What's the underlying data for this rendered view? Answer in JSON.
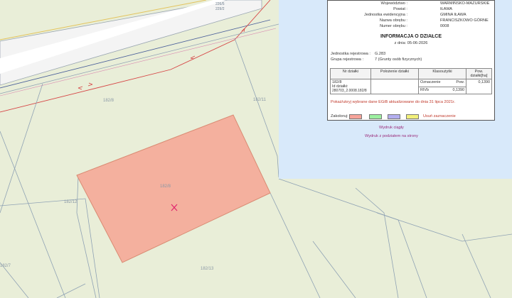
{
  "info_panel": {
    "voivodeship_label": "Województwo :",
    "voivodeship": "WARMIŃSKO-MAZURSKIE",
    "county_label": "Powiat :",
    "county": "IŁAWA",
    "unit_label": "Jednostka ewidencyjna :",
    "unit": "GMINA IŁAWA",
    "precinct_name_label": "Nazwa obrębu :",
    "precinct_name": "FRANCISZKOWO GÓRNE",
    "precinct_number_label": "Numer obrębu :",
    "precinct_number": "0008",
    "title": "INFORMACJA O DZIAŁCE",
    "date_line": "z dnia: 05-06-2026",
    "registry_unit_label": "Jednostka rejestrowa :",
    "registry_unit": "G.283",
    "registry_group_label": "Grupa rejestrowa :",
    "registry_group": "7 (Grunty osób fizycznych)",
    "table": {
      "headers": [
        "Nr działki",
        "Położenie działki",
        "Klasoużytki",
        "Pow. działki[ha]"
      ],
      "sub_headers": [
        "Oznaczenie",
        "Pow."
      ],
      "parcel_number": "182/8",
      "parcel_id_label": "Id działki:",
      "parcel_id": "280703_2.0008.182/8",
      "location": "",
      "land_class": "RIVb",
      "land_class_area": "0,1390",
      "parcel_area": "0,1390"
    },
    "notice": "Pokaż/ukryj wybrane dane EGiB aktualizowane do dnia 31 lipca 2021r.",
    "color_label": "Zakoloruj:",
    "colors": [
      "#f7a49a",
      "#9cf0a0",
      "#b3aef0",
      "#f2f07a"
    ],
    "clear_selection": "Usuń zaznaczenie",
    "print_continuous": "Wydruk ciągły",
    "print_pages": "Wydruk z podziałem na strony"
  },
  "map": {
    "parcel_labels": [
      "182/8",
      "182/8",
      "182/11",
      "182/12",
      "182/13",
      "182/7"
    ],
    "road_labels": [
      "226/5",
      "229/2"
    ],
    "selected_parcel": "182/8",
    "highlight_color": "#f4b09e",
    "marker_color": "#e0246d",
    "boundary_color": "#8fa2b4",
    "red_line_color": "#d64545"
  }
}
